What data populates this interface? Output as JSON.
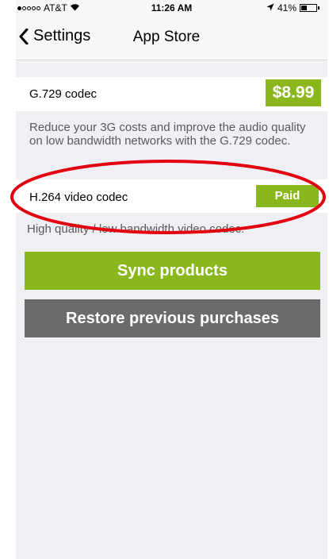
{
  "status_bar": {
    "carrier": "AT&T",
    "time": "11:26 AM",
    "battery": "41%",
    "battery_level": 0.41,
    "signal_bars_filled": 1,
    "signal_bars_total": 5
  },
  "nav": {
    "back_label": "Settings",
    "title": "App Store"
  },
  "products": [
    {
      "name": "G.729 codec",
      "price": "$8.99",
      "description": "Reduce your 3G costs and improve the audio quality on low bandwidth networks with the G.729 codec."
    },
    {
      "name": "H.264 video codec",
      "price": "Paid",
      "description": "High quality / low bandwidth video codec."
    }
  ],
  "buttons": {
    "sync": "Sync products",
    "restore": "Restore previous purchases"
  },
  "colors": {
    "accent_green": "#8ab71c",
    "restore_gray": "#6b6b6b",
    "annotation_red": "#e3000f",
    "background": "#efeff4"
  }
}
